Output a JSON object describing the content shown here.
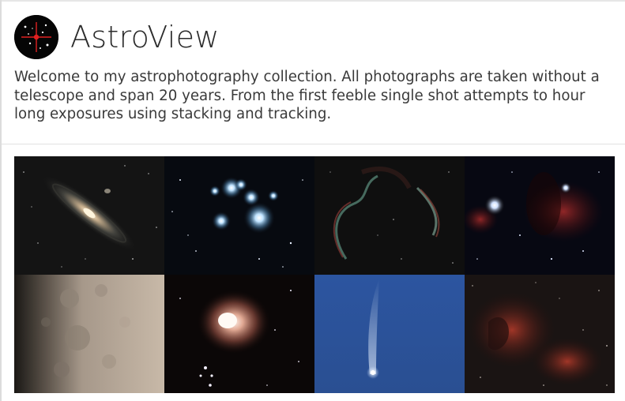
{
  "header": {
    "title": "AstroView",
    "logo_icon": "telescope-crosshair-icon"
  },
  "intro": {
    "text": "Welcome to my astrophotography collection. All photographs are taken without a telescope and span 20 years. From the first feeble single shot attempts to hour long exposures using stacking and tracking."
  },
  "gallery": {
    "photos": [
      {
        "subject": "andromeda-galaxy"
      },
      {
        "subject": "pleiades-cluster"
      },
      {
        "subject": "veil-nebula"
      },
      {
        "subject": "horsehead-flame-nebula"
      },
      {
        "subject": "moon-craters"
      },
      {
        "subject": "orion-nebula"
      },
      {
        "subject": "comet"
      },
      {
        "subject": "north-america-nebula"
      }
    ]
  },
  "colors": {
    "title": "#2b2b2b",
    "text": "#3a3a3a",
    "divider": "#e2e2e2",
    "logo_bg": "#050505",
    "logo_accent": "#e02020"
  }
}
